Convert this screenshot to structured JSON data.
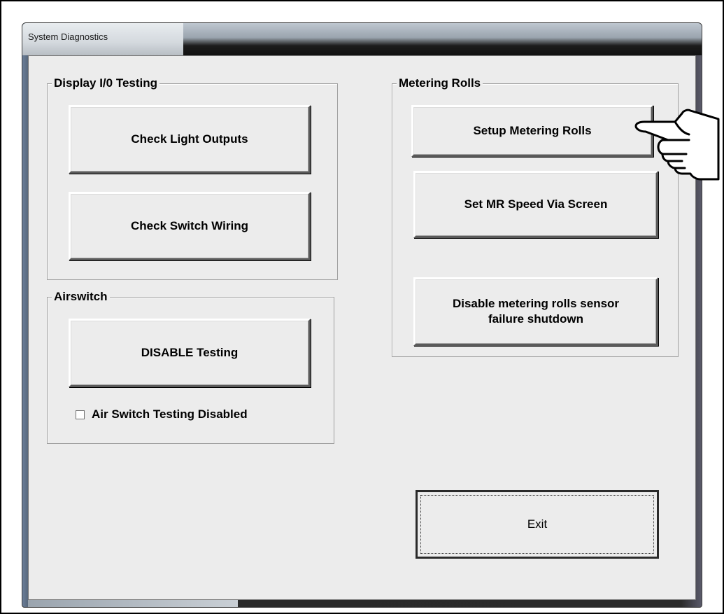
{
  "window": {
    "title": "System Diagnostics"
  },
  "display_io": {
    "label": "Display I/0 Testing",
    "check_light_outputs": "Check Light Outputs",
    "check_switch_wiring": "Check Switch Wiring"
  },
  "airswitch": {
    "label": "Airswitch",
    "disable_testing": "DISABLE Testing",
    "checkbox_label": "Air Switch Testing Disabled",
    "checkbox_checked": false
  },
  "metering_rolls": {
    "label": "Metering Rolls",
    "setup": "Setup Metering Rolls",
    "set_speed": "Set MR Speed Via Screen",
    "disable_line1": "Disable metering rolls sensor",
    "disable_line2": "failure shutdown"
  },
  "exit_label": "Exit",
  "icons": {
    "pointer": "pointing-hand-icon"
  }
}
